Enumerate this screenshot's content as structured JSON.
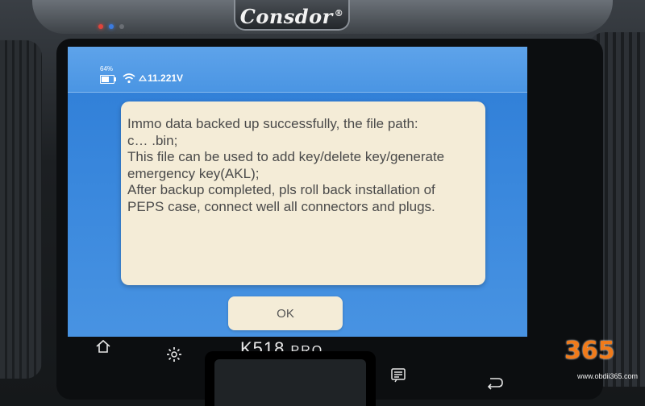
{
  "device": {
    "brand": "Consdor",
    "brand_mark": "®",
    "model": "K518",
    "model_suffix": "PRO"
  },
  "status_bar": {
    "battery_percent": "64%",
    "battery_level": 0.64,
    "wifi_icon": "wifi-icon",
    "voltage_icon": "voltage-icon",
    "voltage": "11.221V"
  },
  "dialog": {
    "message_lines": [
      "Immo data backed up successfully, the file path:",
      "c…      .bin;",
      "This file can be used to add key/delete key/generate",
      "emergency key(AKL);",
      "After backup completed, pls roll back installation of",
      "PEPS case, connect well all connectors and plugs."
    ],
    "ok_label": "OK"
  },
  "nav": {
    "home_icon": "home-icon",
    "settings_icon": "gear-icon",
    "menu_icon": "message-list-icon",
    "back_icon": "back-arrow-icon"
  },
  "watermark": {
    "logo": "365",
    "url": "www.obdii365.com"
  },
  "colors": {
    "screen_blue": "#3a88dd",
    "dialog_bg": "#f4ecd7",
    "led_red": "#e0443b",
    "led_blue": "#3b7be0",
    "watermark_orange": "#f07b1b"
  }
}
